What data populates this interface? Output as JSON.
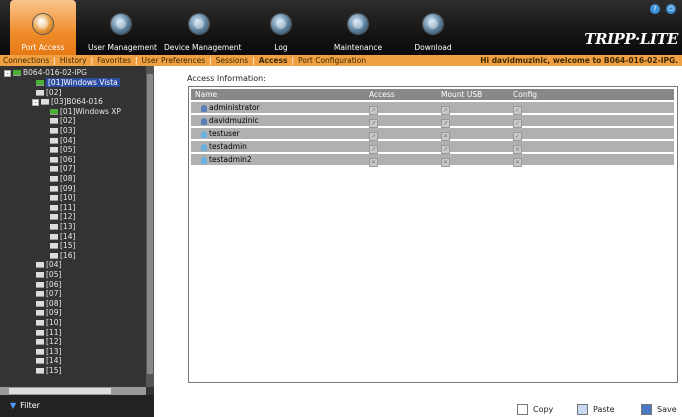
{
  "tabs": [
    {
      "label": "Port Access",
      "icon": "port-access-icon",
      "active": true
    },
    {
      "label": "User Management",
      "icon": "user-management-icon",
      "active": false
    },
    {
      "label": "Device Management",
      "icon": "device-management-icon",
      "active": false
    },
    {
      "label": "Log",
      "icon": "log-icon",
      "active": false
    },
    {
      "label": "Maintenance",
      "icon": "maintenance-icon",
      "active": false
    },
    {
      "label": "Download",
      "icon": "download-icon",
      "active": false
    }
  ],
  "brand": "TRIPP·LITE",
  "subnav": {
    "items": [
      "Connections",
      "History",
      "Favorites",
      "User Preferences",
      "Sessions",
      "Access",
      "Port Configuration"
    ],
    "active": "Access",
    "welcome": "Hi davidmuzinic, welcome to B064-016-02-IPG."
  },
  "tree": {
    "root": "B064-016-02-IPG",
    "items": [
      {
        "label": "[01]Windows Vista",
        "selected": true,
        "green": true
      },
      {
        "label": "[02]"
      },
      {
        "label": "[03]B064-016"
      },
      {
        "label": "[01]Windows XP",
        "green": true
      },
      {
        "label": "[02]"
      },
      {
        "label": "[03]"
      },
      {
        "label": "[04]"
      },
      {
        "label": "[05]"
      },
      {
        "label": "[06]"
      },
      {
        "label": "[07]"
      },
      {
        "label": "[08]"
      },
      {
        "label": "[09]"
      },
      {
        "label": "[10]"
      },
      {
        "label": "[11]"
      },
      {
        "label": "[12]"
      },
      {
        "label": "[13]"
      },
      {
        "label": "[14]"
      },
      {
        "label": "[15]"
      },
      {
        "label": "[16]"
      },
      {
        "label": "[04]"
      },
      {
        "label": "[05]"
      },
      {
        "label": "[06]"
      },
      {
        "label": "[07]"
      },
      {
        "label": "[08]"
      },
      {
        "label": "[09]"
      },
      {
        "label": "[10]"
      },
      {
        "label": "[11]"
      },
      {
        "label": "[12]"
      },
      {
        "label": "[13]"
      },
      {
        "label": "[14]"
      },
      {
        "label": "[15]"
      }
    ]
  },
  "filter_label": "Filter",
  "access": {
    "title": "Access Information:",
    "columns": [
      "Name",
      "Access",
      "Mount USB",
      "Config"
    ],
    "rows": [
      {
        "name": "administrator",
        "access": "allow",
        "mount_usb": "allow",
        "config": "checked"
      },
      {
        "name": "davidmuzinic",
        "access": "allow",
        "mount_usb": "allow",
        "config": "checked"
      },
      {
        "name": "testuser",
        "access": "allow",
        "mount_usb": "denied",
        "config": "checked"
      },
      {
        "name": "testadmin",
        "access": "allow",
        "mount_usb": "allow",
        "config": "denied"
      },
      {
        "name": "testadmin2",
        "access": "denied",
        "mount_usb": "denied",
        "config": "denied"
      }
    ]
  },
  "buttons": {
    "copy": "Copy",
    "paste": "Paste",
    "save": "Save"
  }
}
